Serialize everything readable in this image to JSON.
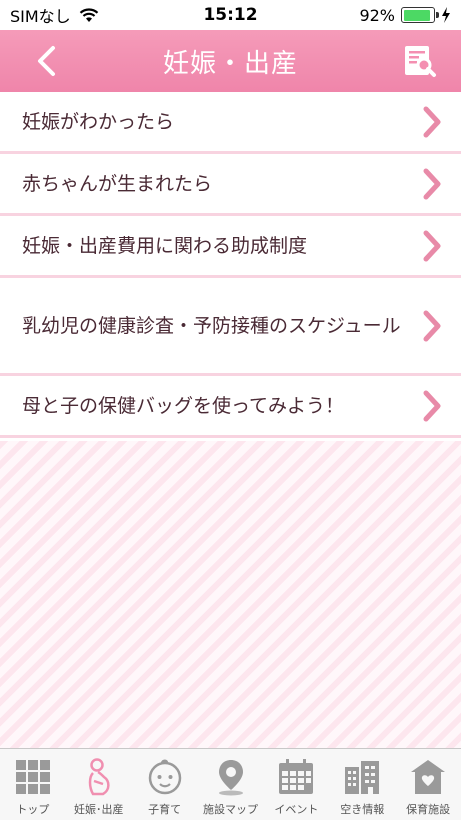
{
  "status_bar": {
    "carrier": "SIMなし",
    "time": "15:12",
    "battery_percent": "92%",
    "battery_level": 0.92
  },
  "header": {
    "title": "妊娠・出産",
    "back_icon": "chevron-left-icon",
    "search_icon": "document-search-icon"
  },
  "menu": {
    "items": [
      {
        "label": "妊娠がわかったら"
      },
      {
        "label": "赤ちゃんが生まれたら"
      },
      {
        "label": "妊娠・出産費用に関わる助成制度"
      },
      {
        "label": "乳幼児の健康診査・予防接種のスケジュール"
      },
      {
        "label": "母と子の保健バッグを使ってみよう！"
      }
    ]
  },
  "tabs": {
    "items": [
      {
        "label": "トップ",
        "icon": "grid-icon"
      },
      {
        "label": "妊娠･出産",
        "icon": "pregnant-woman-icon",
        "active": true
      },
      {
        "label": "子育て",
        "icon": "baby-face-icon"
      },
      {
        "label": "施設マップ",
        "icon": "map-pin-icon"
      },
      {
        "label": "イベント",
        "icon": "calendar-icon"
      },
      {
        "label": "空き情報",
        "icon": "buildings-icon"
      },
      {
        "label": "保育施設",
        "icon": "house-icon"
      }
    ]
  },
  "colors": {
    "header_bg": "#f48fb1",
    "chevron": "#e88aa8",
    "divider": "#f8d3e0",
    "text": "#4a2a35"
  }
}
